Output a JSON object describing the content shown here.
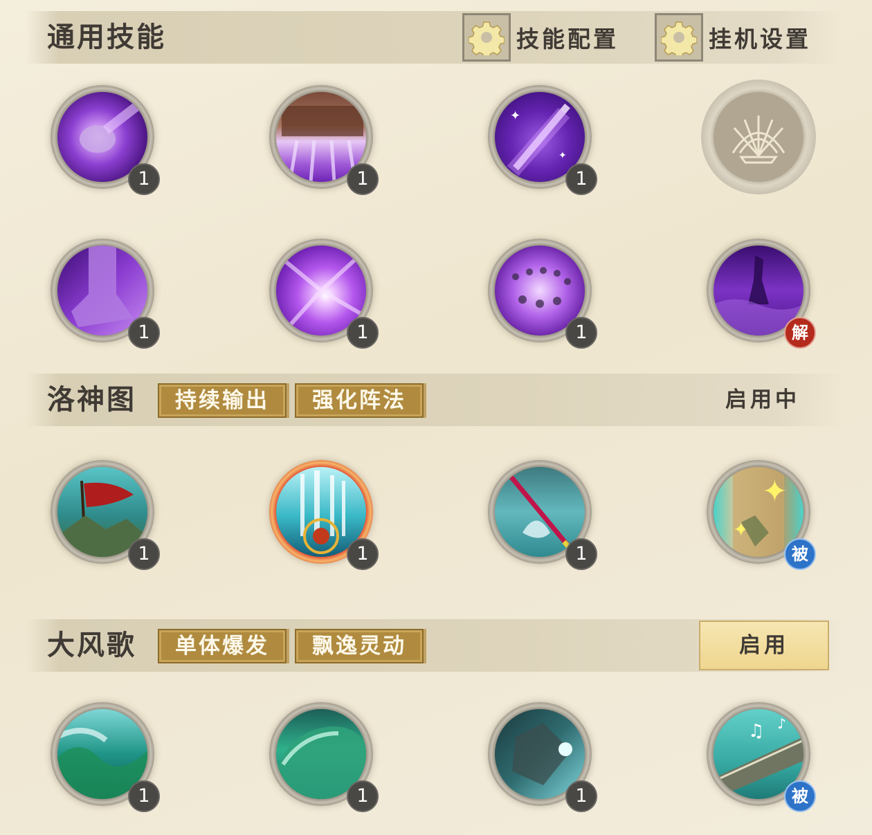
{
  "general": {
    "title": "通用技能",
    "skill_config_label": "技能配置",
    "auto_config_label": "挂机设置",
    "skills": [
      {
        "icon": "purple-meteor-skill-icon",
        "level": "1"
      },
      {
        "icon": "purple-zither-skill-icon",
        "level": "1"
      },
      {
        "icon": "purple-comet-skill-icon",
        "level": "1"
      },
      {
        "icon": "fan-locked-skill-icon",
        "level": ""
      },
      {
        "icon": "purple-boot-skill-icon",
        "level": "1"
      },
      {
        "icon": "purple-burst-skill-icon",
        "level": "1"
      },
      {
        "icon": "purple-array-skill-icon",
        "level": "1"
      },
      {
        "icon": "purple-goddess-skill-icon",
        "level": "",
        "badge": "解"
      }
    ]
  },
  "luoshen": {
    "title": "洛神图",
    "tags": [
      "持续输出",
      "强化阵法"
    ],
    "status": "启用中",
    "skills": [
      {
        "icon": "war-banner-skill-icon",
        "level": "1"
      },
      {
        "icon": "light-pillar-array-skill-icon",
        "level": "1"
      },
      {
        "icon": "water-staff-skill-icon",
        "level": "1"
      },
      {
        "icon": "scroll-explosion-skill-icon",
        "level": "",
        "badge": "被"
      }
    ]
  },
  "dafengge": {
    "title": "大风歌",
    "tags": [
      "单体爆发",
      "飘逸灵动"
    ],
    "enable_label": "启用",
    "skills": [
      {
        "icon": "green-wave-skill-icon",
        "level": "1"
      },
      {
        "icon": "teal-wave-skill-icon",
        "level": "1"
      },
      {
        "icon": "spirit-strike-skill-icon",
        "level": "1"
      },
      {
        "icon": "guzheng-music-skill-icon",
        "level": "",
        "badge": "被"
      }
    ]
  },
  "colors": {
    "tag_gold": "#b08b3f",
    "badge_red": "#b42b1d",
    "badge_blue": "#2d73c8",
    "enable_button": "#efd68f"
  }
}
